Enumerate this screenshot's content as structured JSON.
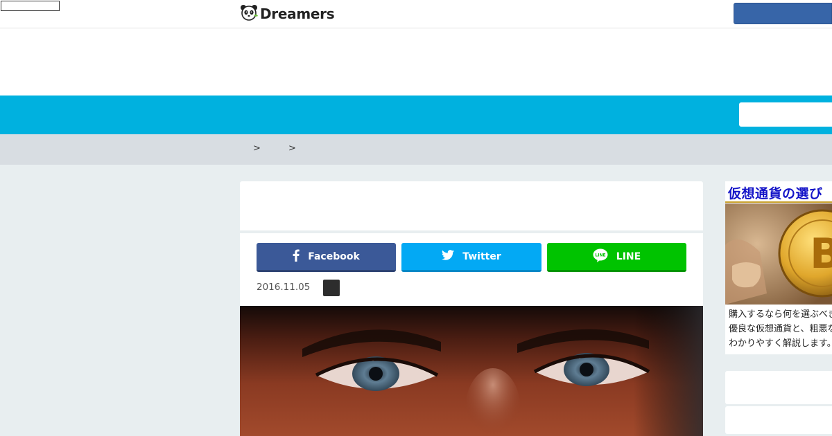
{
  "header": {
    "logo_text": "Dreamers",
    "logo_icon": "panda-icon"
  },
  "breadcrumb": {
    "separators": [
      ">",
      ">"
    ]
  },
  "share": {
    "facebook_label": "Facebook",
    "twitter_label": "Twitter",
    "line_label": "LINE"
  },
  "article": {
    "date": "2016.11.05"
  },
  "sidebar_ad": {
    "title": "仮想通貨の選び",
    "lines": [
      "購入するなら何を選ぶべき",
      "優良な仮想通貨と、粗悪な",
      "わかりやすく解説します。"
    ],
    "coin_symbol": "B"
  },
  "colors": {
    "nav_blue": "#00b1df",
    "header_button": "#3765a8",
    "facebook": "#3b5998",
    "twitter": "#03a9f4",
    "line": "#00c300",
    "ad_title": "#1414c8"
  }
}
